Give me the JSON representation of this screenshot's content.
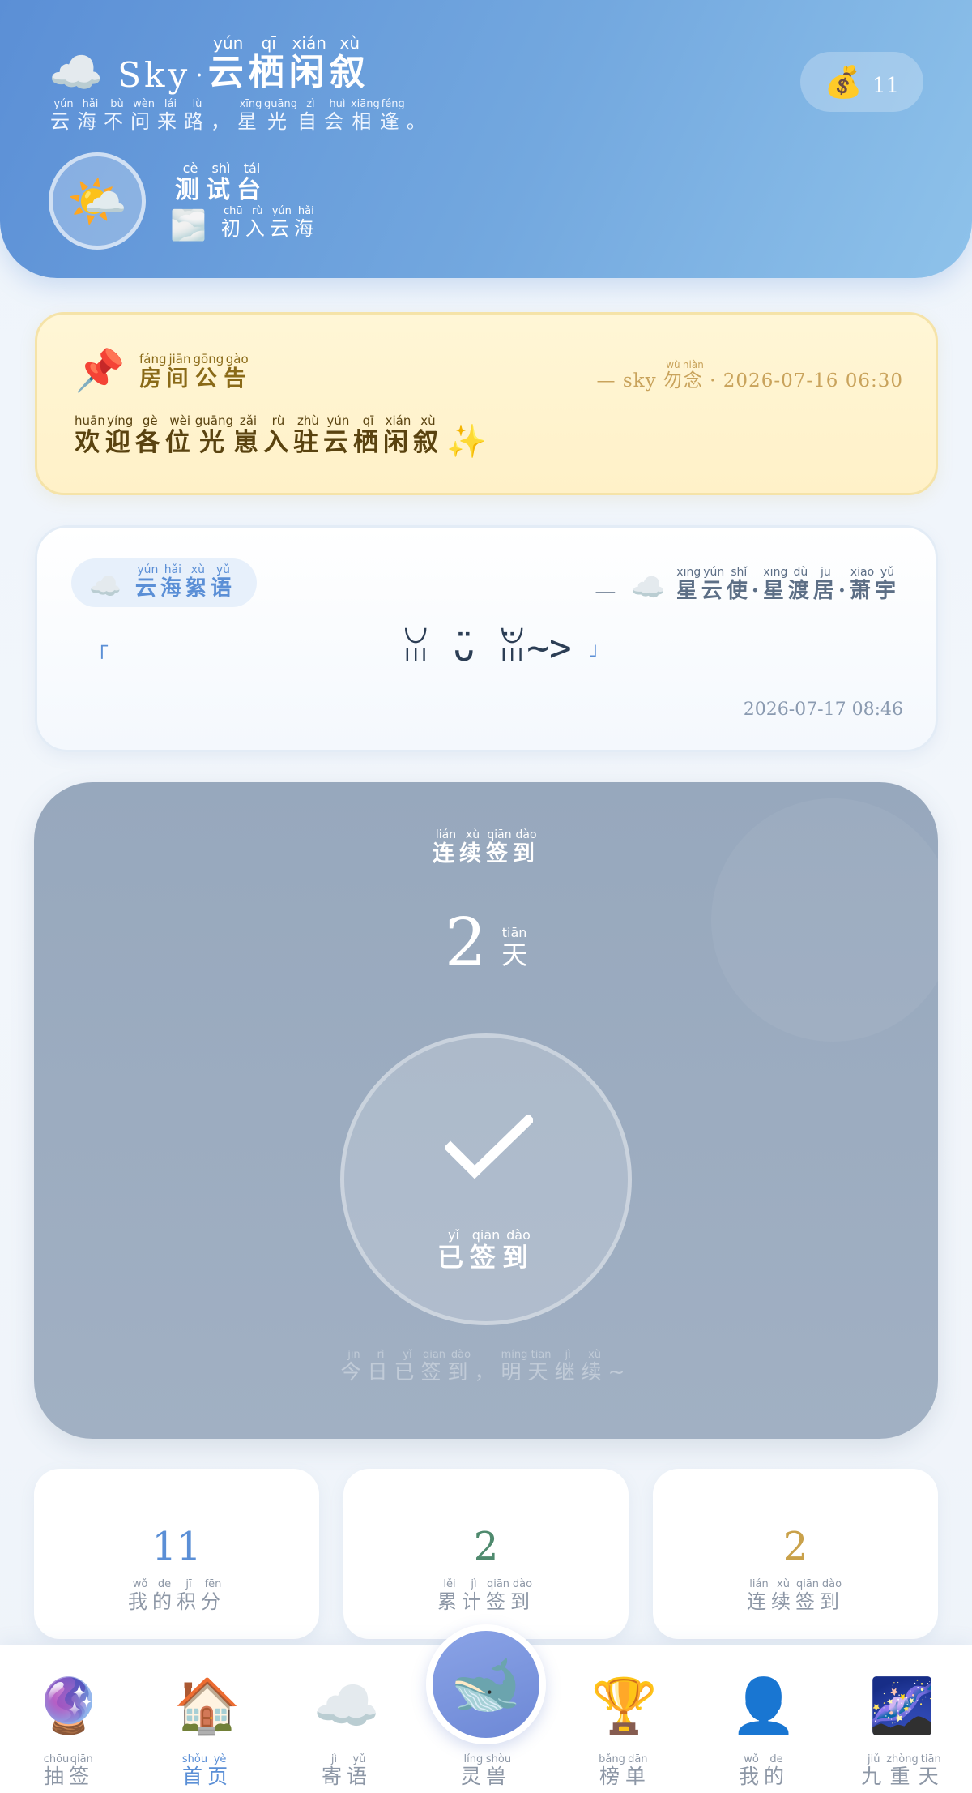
{
  "header": {
    "brand_icon": "cloud-icon",
    "brand_en": "Sky",
    "brand_sep": "·",
    "brand_zh": [
      [
        "云",
        "yún"
      ],
      [
        "栖",
        "qī"
      ],
      [
        "闲",
        "xián"
      ],
      [
        "叙",
        "xù"
      ]
    ],
    "slogan": [
      [
        "云",
        "yún"
      ],
      [
        "海",
        "hǎi"
      ],
      [
        "不",
        "bù"
      ],
      [
        "问",
        "wèn"
      ],
      [
        "来",
        "lái"
      ],
      [
        "路",
        "lù"
      ],
      [
        "，",
        ""
      ],
      [
        "星",
        "xīng"
      ],
      [
        "光",
        "guāng"
      ],
      [
        "自",
        "zì"
      ],
      [
        "会",
        "huì"
      ],
      [
        "相",
        "xiāng"
      ],
      [
        "逢",
        "féng"
      ],
      [
        "。",
        ""
      ]
    ],
    "avatar_icon": "sun-behind-cloud-icon",
    "username": [
      [
        "测",
        "cè"
      ],
      [
        "试",
        "shì"
      ],
      [
        "台",
        "tái"
      ]
    ],
    "level_icon": "fog-icon",
    "level": [
      [
        "初",
        "chū"
      ],
      [
        "入",
        "rù"
      ],
      [
        "云",
        "yún"
      ],
      [
        "海",
        "hǎi"
      ]
    ],
    "coins_icon": "money-bag-icon",
    "coins": "11"
  },
  "notice": {
    "icon": "pushpin-icon",
    "title": [
      [
        "房",
        "fáng"
      ],
      [
        "间",
        "jiān"
      ],
      [
        "公",
        "gōng"
      ],
      [
        "告",
        "gào"
      ]
    ],
    "meta_prefix": "— sky",
    "meta_tag": [
      [
        "勿",
        "wù"
      ],
      [
        "念",
        "niàn"
      ]
    ],
    "meta_time": "· 2026-07-16 06:30",
    "body": [
      [
        "欢",
        "huān"
      ],
      [
        "迎",
        "yíng"
      ],
      [
        "各",
        "gè"
      ],
      [
        "位",
        "wèi"
      ],
      [
        "光",
        "guāng"
      ],
      [
        "崽",
        "zǎi"
      ],
      [
        "入",
        "rù"
      ],
      [
        "驻",
        "zhù"
      ],
      [
        "云",
        "yún"
      ],
      [
        "栖",
        "qī"
      ],
      [
        "闲",
        "xián"
      ],
      [
        "叙",
        "xù"
      ]
    ],
    "body_icon": "sparkles-icon"
  },
  "words": {
    "tag_icon": "cloud-icon",
    "tag": [
      [
        "云",
        "yún"
      ],
      [
        "海",
        "hǎi"
      ],
      [
        "絮",
        "xù"
      ],
      [
        "语",
        "yǔ"
      ]
    ],
    "author_dash": "—",
    "author_icon": "cloud-icon",
    "author": [
      [
        "星",
        "xīng"
      ],
      [
        "云",
        "yún"
      ],
      [
        "使",
        "shǐ"
      ],
      [
        "·",
        ""
      ],
      [
        "星",
        "xīng"
      ],
      [
        "渡",
        "dù"
      ],
      [
        "居",
        "jū"
      ],
      [
        "·",
        ""
      ],
      [
        "萧",
        "xiāo"
      ],
      [
        "宇",
        "yǔ"
      ]
    ],
    "quote_open": "「",
    "quote": "ꈍ ̈ᴗ ̈ꈍ~>",
    "quote_close": "」",
    "time": "2026-07-17 08:46"
  },
  "checkin": {
    "title": [
      [
        "连",
        "lián"
      ],
      [
        "续",
        "xù"
      ],
      [
        "签",
        "qiān"
      ],
      [
        "到",
        "dào"
      ]
    ],
    "days": "2",
    "days_unit": [
      [
        "天",
        "tiān"
      ]
    ],
    "status_icon": "checkmark-icon",
    "status": [
      [
        "已",
        "yǐ"
      ],
      [
        "签",
        "qiān"
      ],
      [
        "到",
        "dào"
      ]
    ],
    "tip": [
      [
        "今",
        "jīn"
      ],
      [
        "日",
        "rì"
      ],
      [
        "已",
        "yǐ"
      ],
      [
        "签",
        "qiān"
      ],
      [
        "到",
        "dào"
      ],
      [
        "，",
        ""
      ],
      [
        "明",
        "míng"
      ],
      [
        "天",
        "tiān"
      ],
      [
        "继",
        "jì"
      ],
      [
        "续",
        "xù"
      ],
      [
        "~",
        ""
      ]
    ]
  },
  "stats": [
    {
      "value": "11",
      "label": [
        [
          "我",
          "wǒ"
        ],
        [
          "的",
          "de"
        ],
        [
          "积",
          "jī"
        ],
        [
          "分",
          "fēn"
        ]
      ],
      "color": "#5b8fd6"
    },
    {
      "value": "2",
      "label": [
        [
          "累",
          "lěi"
        ],
        [
          "计",
          "jì"
        ],
        [
          "签",
          "qiān"
        ],
        [
          "到",
          "dào"
        ]
      ],
      "color": "#4f8a6e"
    },
    {
      "value": "2",
      "label": [
        [
          "连",
          "lián"
        ],
        [
          "续",
          "xù"
        ],
        [
          "签",
          "qiān"
        ],
        [
          "到",
          "dào"
        ]
      ],
      "color": "#c9a14a"
    }
  ],
  "nav": {
    "items": [
      {
        "icon": "crystal-ball-icon",
        "label": [
          [
            "抽",
            "chōu"
          ],
          [
            "签",
            "qiān"
          ]
        ],
        "active": false
      },
      {
        "icon": "house-icon",
        "label": [
          [
            "首",
            "shǒu"
          ],
          [
            "页",
            "yè"
          ]
        ],
        "active": true
      },
      {
        "icon": "cloud-icon",
        "label": [
          [
            "寄",
            "jì"
          ],
          [
            "语",
            "yǔ"
          ]
        ],
        "active": false
      },
      {
        "icon": "whale-icon",
        "label": [
          [
            "灵",
            "líng"
          ],
          [
            "兽",
            "shòu"
          ]
        ],
        "active": false
      },
      {
        "icon": "trophy-icon",
        "label": [
          [
            "榜",
            "bǎng"
          ],
          [
            "单",
            "dān"
          ]
        ],
        "active": false
      },
      {
        "icon": "user-icon",
        "label": [
          [
            "我",
            "wǒ"
          ],
          [
            "的",
            "de"
          ]
        ],
        "active": false
      },
      {
        "icon": "milky-way-icon",
        "label": [
          [
            "九",
            "jiǔ"
          ],
          [
            "重",
            "zhòng"
          ],
          [
            "天",
            "tiān"
          ]
        ],
        "active": false
      }
    ]
  },
  "colors": {
    "header_start": "#5b8fd6",
    "header_end": "#8ec2ea",
    "notice_bg": "#fff6d6",
    "checkin_bg": "#9aaabf",
    "accent": "#5b8fd6"
  }
}
